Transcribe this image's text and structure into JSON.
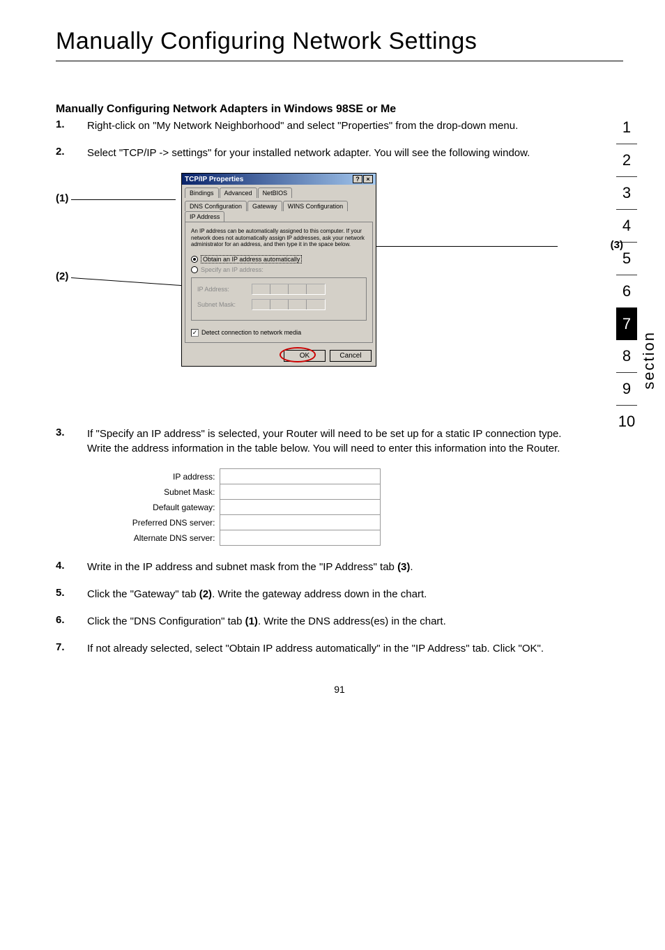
{
  "page_title": "Manually Configuring Network Settings",
  "section_label": "section",
  "nav_numbers": [
    "1",
    "2",
    "3",
    "4",
    "5",
    "6",
    "7",
    "8",
    "9",
    "10"
  ],
  "nav_active_index": 6,
  "subheading": "Manually Configuring Network Adapters in Windows 98SE or Me",
  "steps": {
    "s1_n": "1.",
    "s1_t": "Right-click on \"My Network Neighborhood\" and select \"Properties\" from the drop-down menu.",
    "s2_n": "2.",
    "s2_t": "Select \"TCP/IP -> settings\" for your installed network adapter. You will see the following window.",
    "s3_n": "3.",
    "s3_t": "If \"Specify an IP address\" is selected, your Router will need to be set up for a static IP connection type. Write the address information in the table below. You will need to enter this information into the Router.",
    "s4_n": "4.",
    "s4_t_a": "Write in the IP address and subnet mask from the \"IP Address\" tab ",
    "s4_t_b": "(3)",
    "s4_t_c": ".",
    "s5_n": "5.",
    "s5_t_a": "Click the \"Gateway\" tab ",
    "s5_t_b": "(2)",
    "s5_t_c": ". Write the gateway address down in the chart.",
    "s6_n": "6.",
    "s6_t_a": "Click the \"DNS Configuration\" tab ",
    "s6_t_b": "(1)",
    "s6_t_c": ". Write the DNS address(es) in the chart.",
    "s7_n": "7.",
    "s7_t": "If not already selected, select \"Obtain IP address automatically\" in the \"IP Address\" tab. Click \"OK\"."
  },
  "pointer_labels": {
    "p1": "(1)",
    "p2": "(2)",
    "p3": "(3)"
  },
  "dialog": {
    "title": "TCP/IP Properties",
    "tabs_top": [
      "Bindings",
      "Advanced",
      "NetBIOS"
    ],
    "tabs_bottom": [
      "DNS Configuration",
      "Gateway",
      "WINS Configuration",
      "IP Address"
    ],
    "desc": "An IP address can be automatically assigned to this computer. If your network does not automatically assign IP addresses, ask your network administrator for an address, and then type it in the space below.",
    "radio_auto": "Obtain an IP address automatically",
    "radio_specify": "Specify an IP address:",
    "ip_label": "IP Address:",
    "subnet_label": "Subnet Mask:",
    "detect_label": "Detect connection to network media",
    "ok": "OK",
    "cancel": "Cancel"
  },
  "form_labels": {
    "ip": "IP address:",
    "subnet": "Subnet Mask:",
    "gateway": "Default gateway:",
    "pref_dns": "Preferred DNS server:",
    "alt_dns": "Alternate DNS server:"
  },
  "page_number": "91"
}
